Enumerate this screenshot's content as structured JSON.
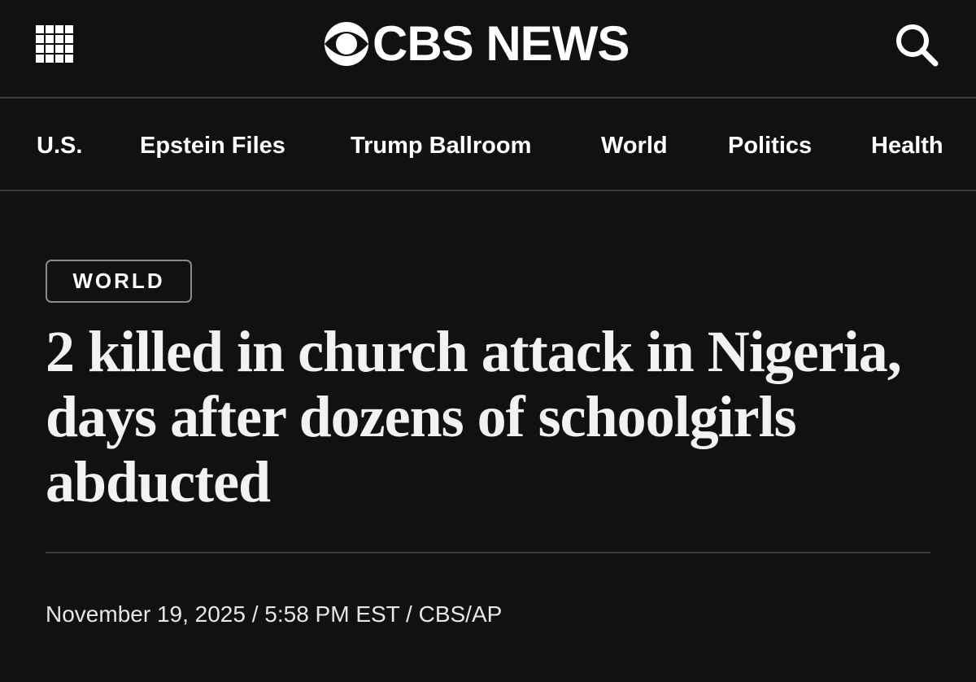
{
  "header": {
    "menu_icon": "grid-menu-icon",
    "logo_icon": "cbs-eye-icon",
    "logo_text": "CBS NEWS",
    "search_icon": "search-icon"
  },
  "nav": {
    "items": [
      {
        "label": "U.S."
      },
      {
        "label": "Epstein Files"
      },
      {
        "label": "Trump Ballroom"
      },
      {
        "label": "World"
      },
      {
        "label": "Politics"
      },
      {
        "label": "Health"
      }
    ]
  },
  "article": {
    "category": "WORLD",
    "headline": "2 killed in church attack in Nigeria, days after dozens of schoolgirls abducted",
    "byline": "November 19, 2025 / 5:58 PM EST / CBS/AP"
  },
  "colors": {
    "background": "#111111",
    "text": "#ffffff",
    "divider": "#3a3a3a",
    "badge_border": "#8a8a8a"
  }
}
